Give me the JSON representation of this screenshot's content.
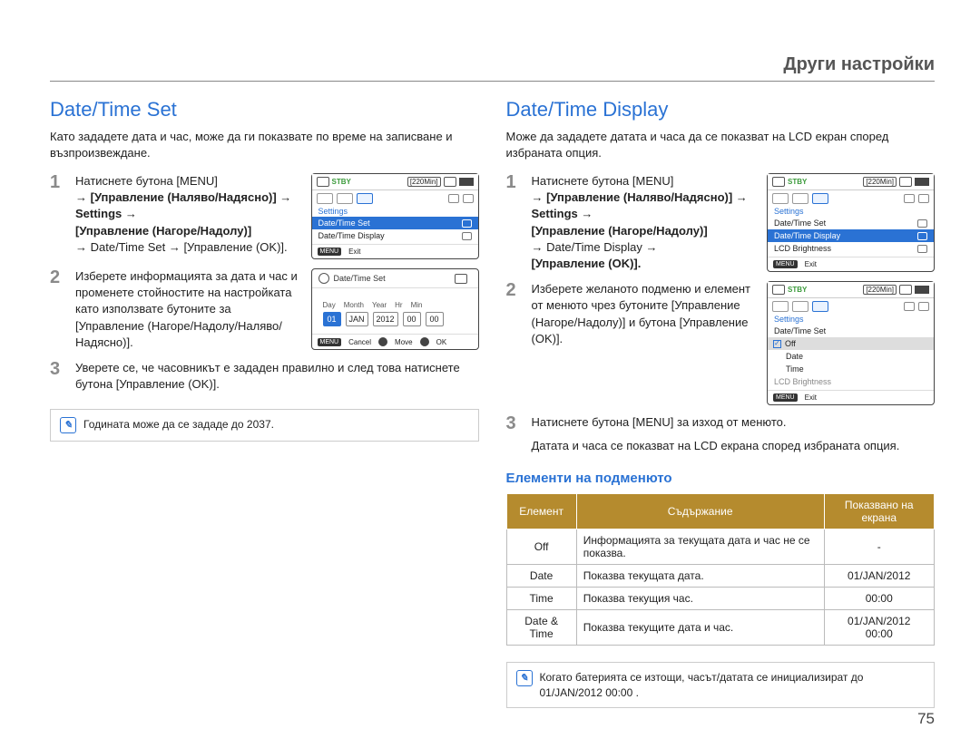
{
  "chapter": "Други настройки",
  "page_number": "75",
  "left": {
    "heading": "Date/Time Set",
    "intro": "Като зададете дата и час, може да ги показвате по време на записване и възпроизвеждане.",
    "step1_a": "Натиснете бутона [MENU]",
    "step1_b": "→ [Управление (Наляво/Надясно)] → Settings →",
    "step1_c": "[Управление (Нагоре/Надолу)]",
    "step1_d": "→ Date/Time Set → [Управление",
    "step1_e": "(OK)].",
    "step2": "Изберете информацията за дата и час и променете стойностите на настройката като използвате бутоните за [Управление (Нагоре/Надолу/Наляво/Надясно)].",
    "step3": "Уверете се, че часовникът е зададен правилно и след това натиснете бутона [Управление (OK)].",
    "note": "Годината може да се зададе до 2037.",
    "screen1": {
      "stby": "STBY",
      "min": "[220Min]",
      "settings": "Settings",
      "item1": "Date/Time Set",
      "item2": "Date/Time Display",
      "menu": "MENU",
      "exit": "Exit"
    },
    "screen2": {
      "title": "Date/Time Set",
      "labels": {
        "day": "Day",
        "month": "Month",
        "year": "Year",
        "hr": "Hr",
        "min": "Min"
      },
      "vals": {
        "day": "01",
        "month": "JAN",
        "year": "2012",
        "hr": "00",
        "min": "00"
      },
      "menu": "MENU",
      "cancel": "Cancel",
      "move": "Move",
      "ok": "OK"
    }
  },
  "right": {
    "heading": "Date/Time Display",
    "intro": "Може да зададете датата и часа да се показват на LCD екран според избраната опция.",
    "step1_a": "Натиснете бутона [MENU]",
    "step1_b": "→ [Управление (Наляво/Надясно)] → Settings →",
    "step1_c": "[Управление (Нагоре/Надолу)]",
    "step1_d": "→ Date/Time Display →",
    "step1_e": "[Управление (OK)].",
    "step2": "Изберете желаното подменю и елемент от менюто чрез бутоните [Управление (Нагоре/Надолу)] и бутона [Управление (OK)].",
    "step3": "Натиснете бутона [MENU] за изход от менюто.",
    "step3b": "Датата и часа се показват на LCD екрана според избраната опция.",
    "screen1": {
      "stby": "STBY",
      "min": "[220Min]",
      "settings": "Settings",
      "item1": "Date/Time Set",
      "item2": "Date/Time Display",
      "item3": "LCD Brightness",
      "menu": "MENU",
      "exit": "Exit"
    },
    "screen2": {
      "stby": "STBY",
      "min": "[220Min]",
      "settings": "Settings",
      "item1": "Date/Time Set",
      "opt_off": "Off",
      "opt_date": "Date",
      "opt_time": "Time",
      "item3": "LCD Brightness",
      "menu": "MENU",
      "exit": "Exit"
    },
    "subhead": "Елементи на подменюто",
    "table": {
      "h1": "Елемент",
      "h2": "Съдържание",
      "h3": "Показвано на екрана",
      "r1c1": "Off",
      "r1c2": "Информацията за текущата дата и час не се показва.",
      "r1c3": "-",
      "r2c1": "Date",
      "r2c2": "Показва текущата дата.",
      "r2c3": "01/JAN/2012",
      "r3c1": "Time",
      "r3c2": "Показва текущия час.",
      "r3c3": "00:00",
      "r4c1": "Date & Time",
      "r4c2": "Показва текущите дата и час.",
      "r4c3a": "01/JAN/2012",
      "r4c3b": "00:00"
    },
    "note": "Когато батерията се изтощи, часът/датата се инициализират до 01/JAN/2012 00:00 ."
  }
}
